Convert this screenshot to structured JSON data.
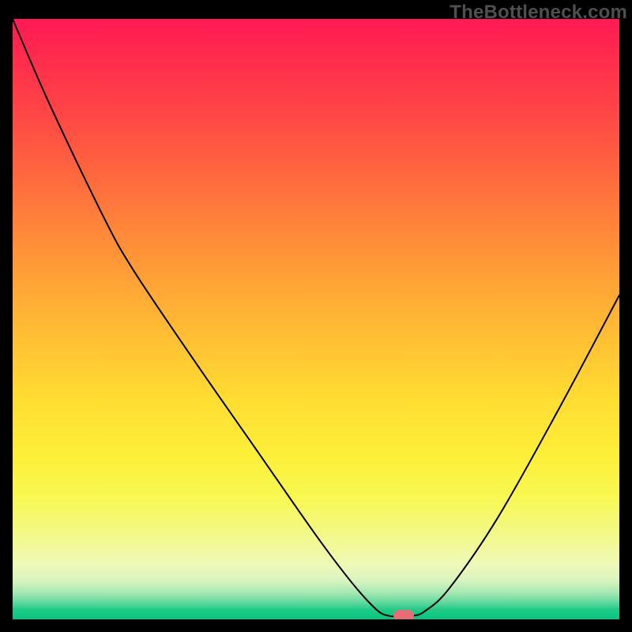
{
  "watermark": "TheBottleneck.com",
  "chart_data": {
    "type": "line",
    "title": "",
    "xlabel": "",
    "ylabel": "",
    "xlim": [
      0,
      100
    ],
    "ylim": [
      0,
      100
    ],
    "series": [
      {
        "name": "bottleneck-curve",
        "x": [
          0,
          6,
          15,
          20,
          30,
          40,
          50,
          56,
          60,
          62,
          64,
          66,
          68,
          72,
          80,
          90,
          100
        ],
        "values": [
          100,
          86,
          67,
          58,
          43,
          28.5,
          14,
          6,
          1.6,
          0.6,
          0.5,
          0.6,
          1.4,
          5.2,
          17,
          35,
          54
        ]
      }
    ],
    "marker": {
      "x": 64.5,
      "y": 0.6,
      "color": "#e86b78"
    },
    "gradient_stops": [
      {
        "pct": 0,
        "color": "#ff1a53"
      },
      {
        "pct": 14,
        "color": "#ff4147"
      },
      {
        "pct": 34,
        "color": "#ff833a"
      },
      {
        "pct": 54,
        "color": "#ffc233"
      },
      {
        "pct": 72,
        "color": "#fdee38"
      },
      {
        "pct": 86,
        "color": "#f3f989"
      },
      {
        "pct": 95.5,
        "color": "#a6e9b4"
      },
      {
        "pct": 100,
        "color": "#06c57f"
      }
    ]
  }
}
